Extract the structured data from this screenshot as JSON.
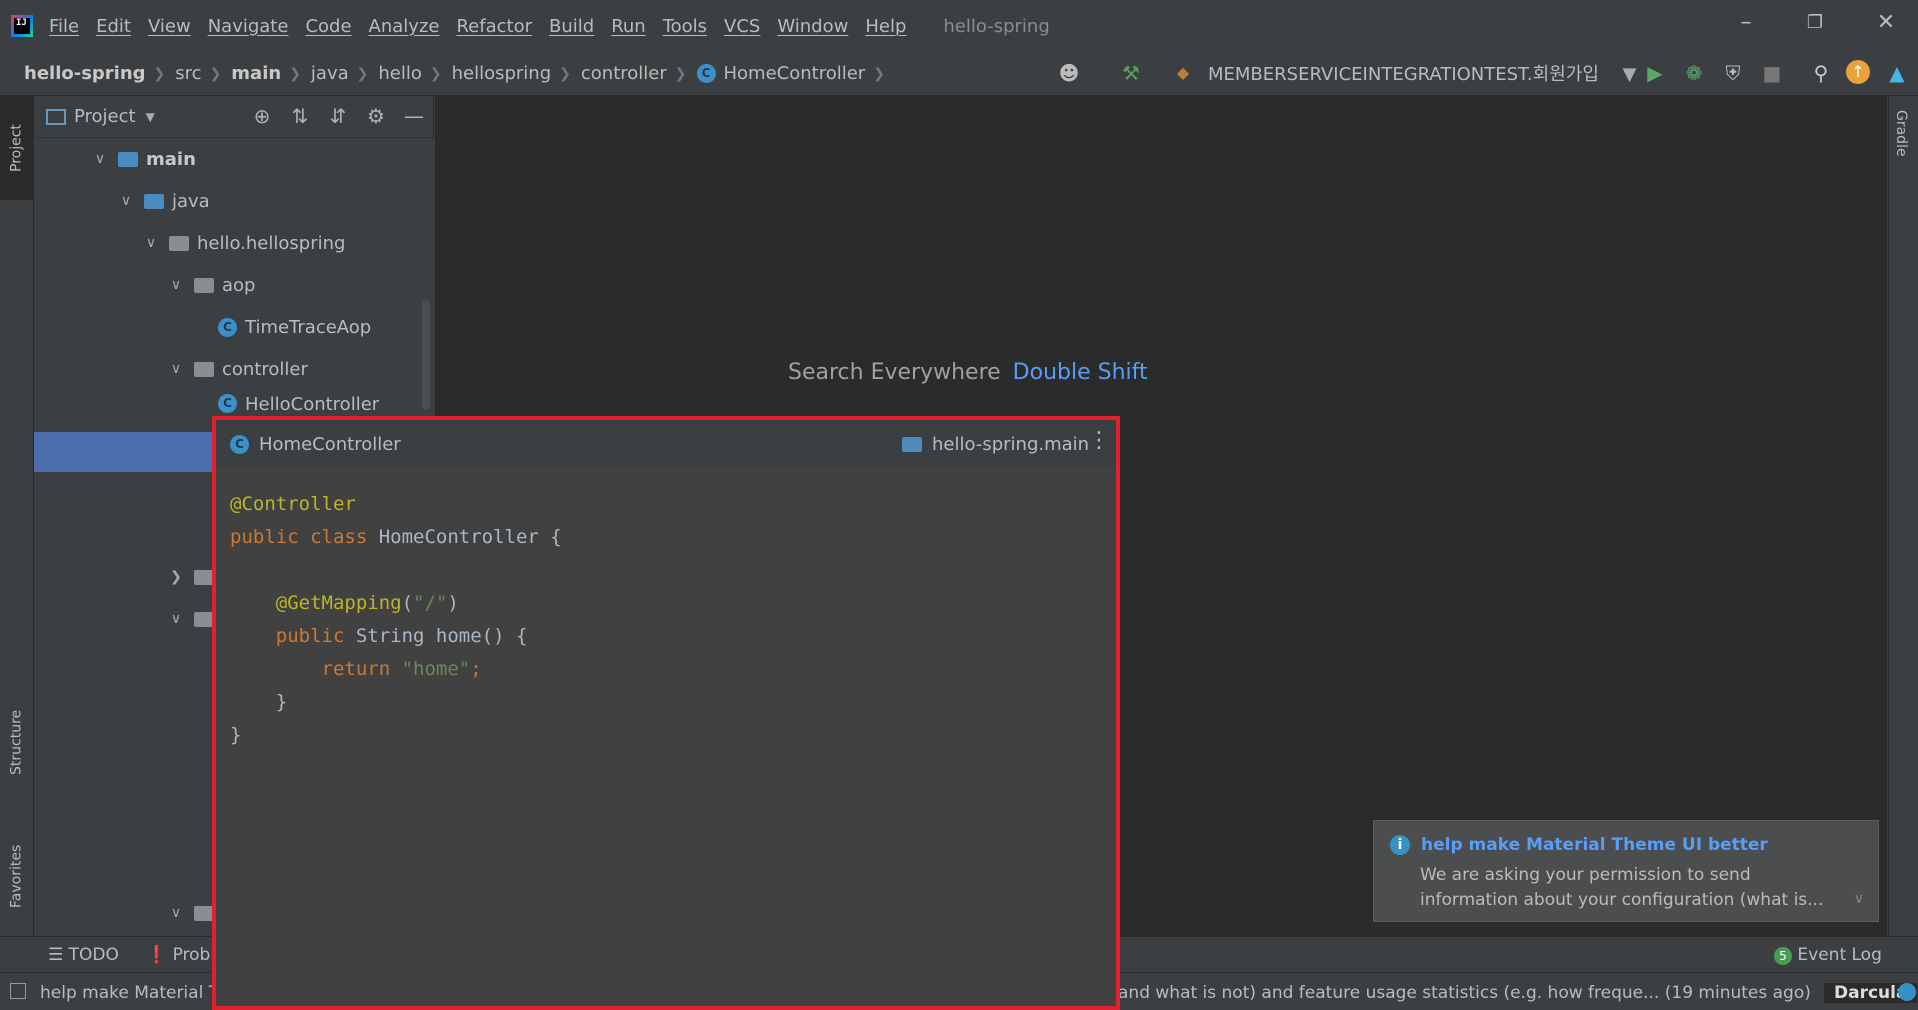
{
  "menu": {
    "items": [
      "File",
      "Edit",
      "View",
      "Navigate",
      "Code",
      "Analyze",
      "Refactor",
      "Build",
      "Run",
      "Tools",
      "VCS",
      "Window",
      "Help"
    ],
    "project_name": "hello-spring"
  },
  "navbar": {
    "crumbs": [
      "hello-spring",
      "src",
      "main",
      "java",
      "hello",
      "hellospring",
      "controller",
      "HomeController"
    ],
    "run_config": "MEMBERSERVICEINTEGRATIONTEST.회원가입"
  },
  "project_panel": {
    "title": "Project",
    "tree": [
      {
        "label": "main",
        "expanded": true
      },
      {
        "label": "java",
        "expanded": true
      },
      {
        "label": "hello.hellospring",
        "expanded": true
      },
      {
        "label": "aop",
        "expanded": true
      },
      {
        "label": "TimeTraceAop"
      },
      {
        "label": "controller",
        "expanded": true
      },
      {
        "label": "HelloController"
      }
    ]
  },
  "left_strip": {
    "project": "Project",
    "structure": "Structure",
    "favorites": "Favorites"
  },
  "right_strip": {
    "gradle": "Gradle"
  },
  "editor": {
    "search_label": "Search Everywhere",
    "search_key": "Double Shift"
  },
  "popup": {
    "title": "HomeController",
    "module": "hello-spring.main",
    "code_lines": [
      "@Controller",
      "public class HomeController {",
      "",
      "    @GetMapping(\"/\")",
      "    public String home() {",
      "        return \"home\";",
      "    }",
      "}"
    ]
  },
  "notification": {
    "title": "help make Material Theme UI better",
    "body": "We are asking your permission to send information about your configuration (what is..."
  },
  "bottom_tools": {
    "todo": "TODO",
    "problems": "Probl",
    "event_log": "Event Log",
    "event_count": "5"
  },
  "status": {
    "left": "help make Material T",
    "right": "and what is not) and feature usage statistics (e.g. how freque... (19 minutes ago)",
    "theme": "Darcula"
  },
  "colors": {
    "accent": "#589df6",
    "popup_border": "#e3202d",
    "selection": "#4b6eaf"
  }
}
